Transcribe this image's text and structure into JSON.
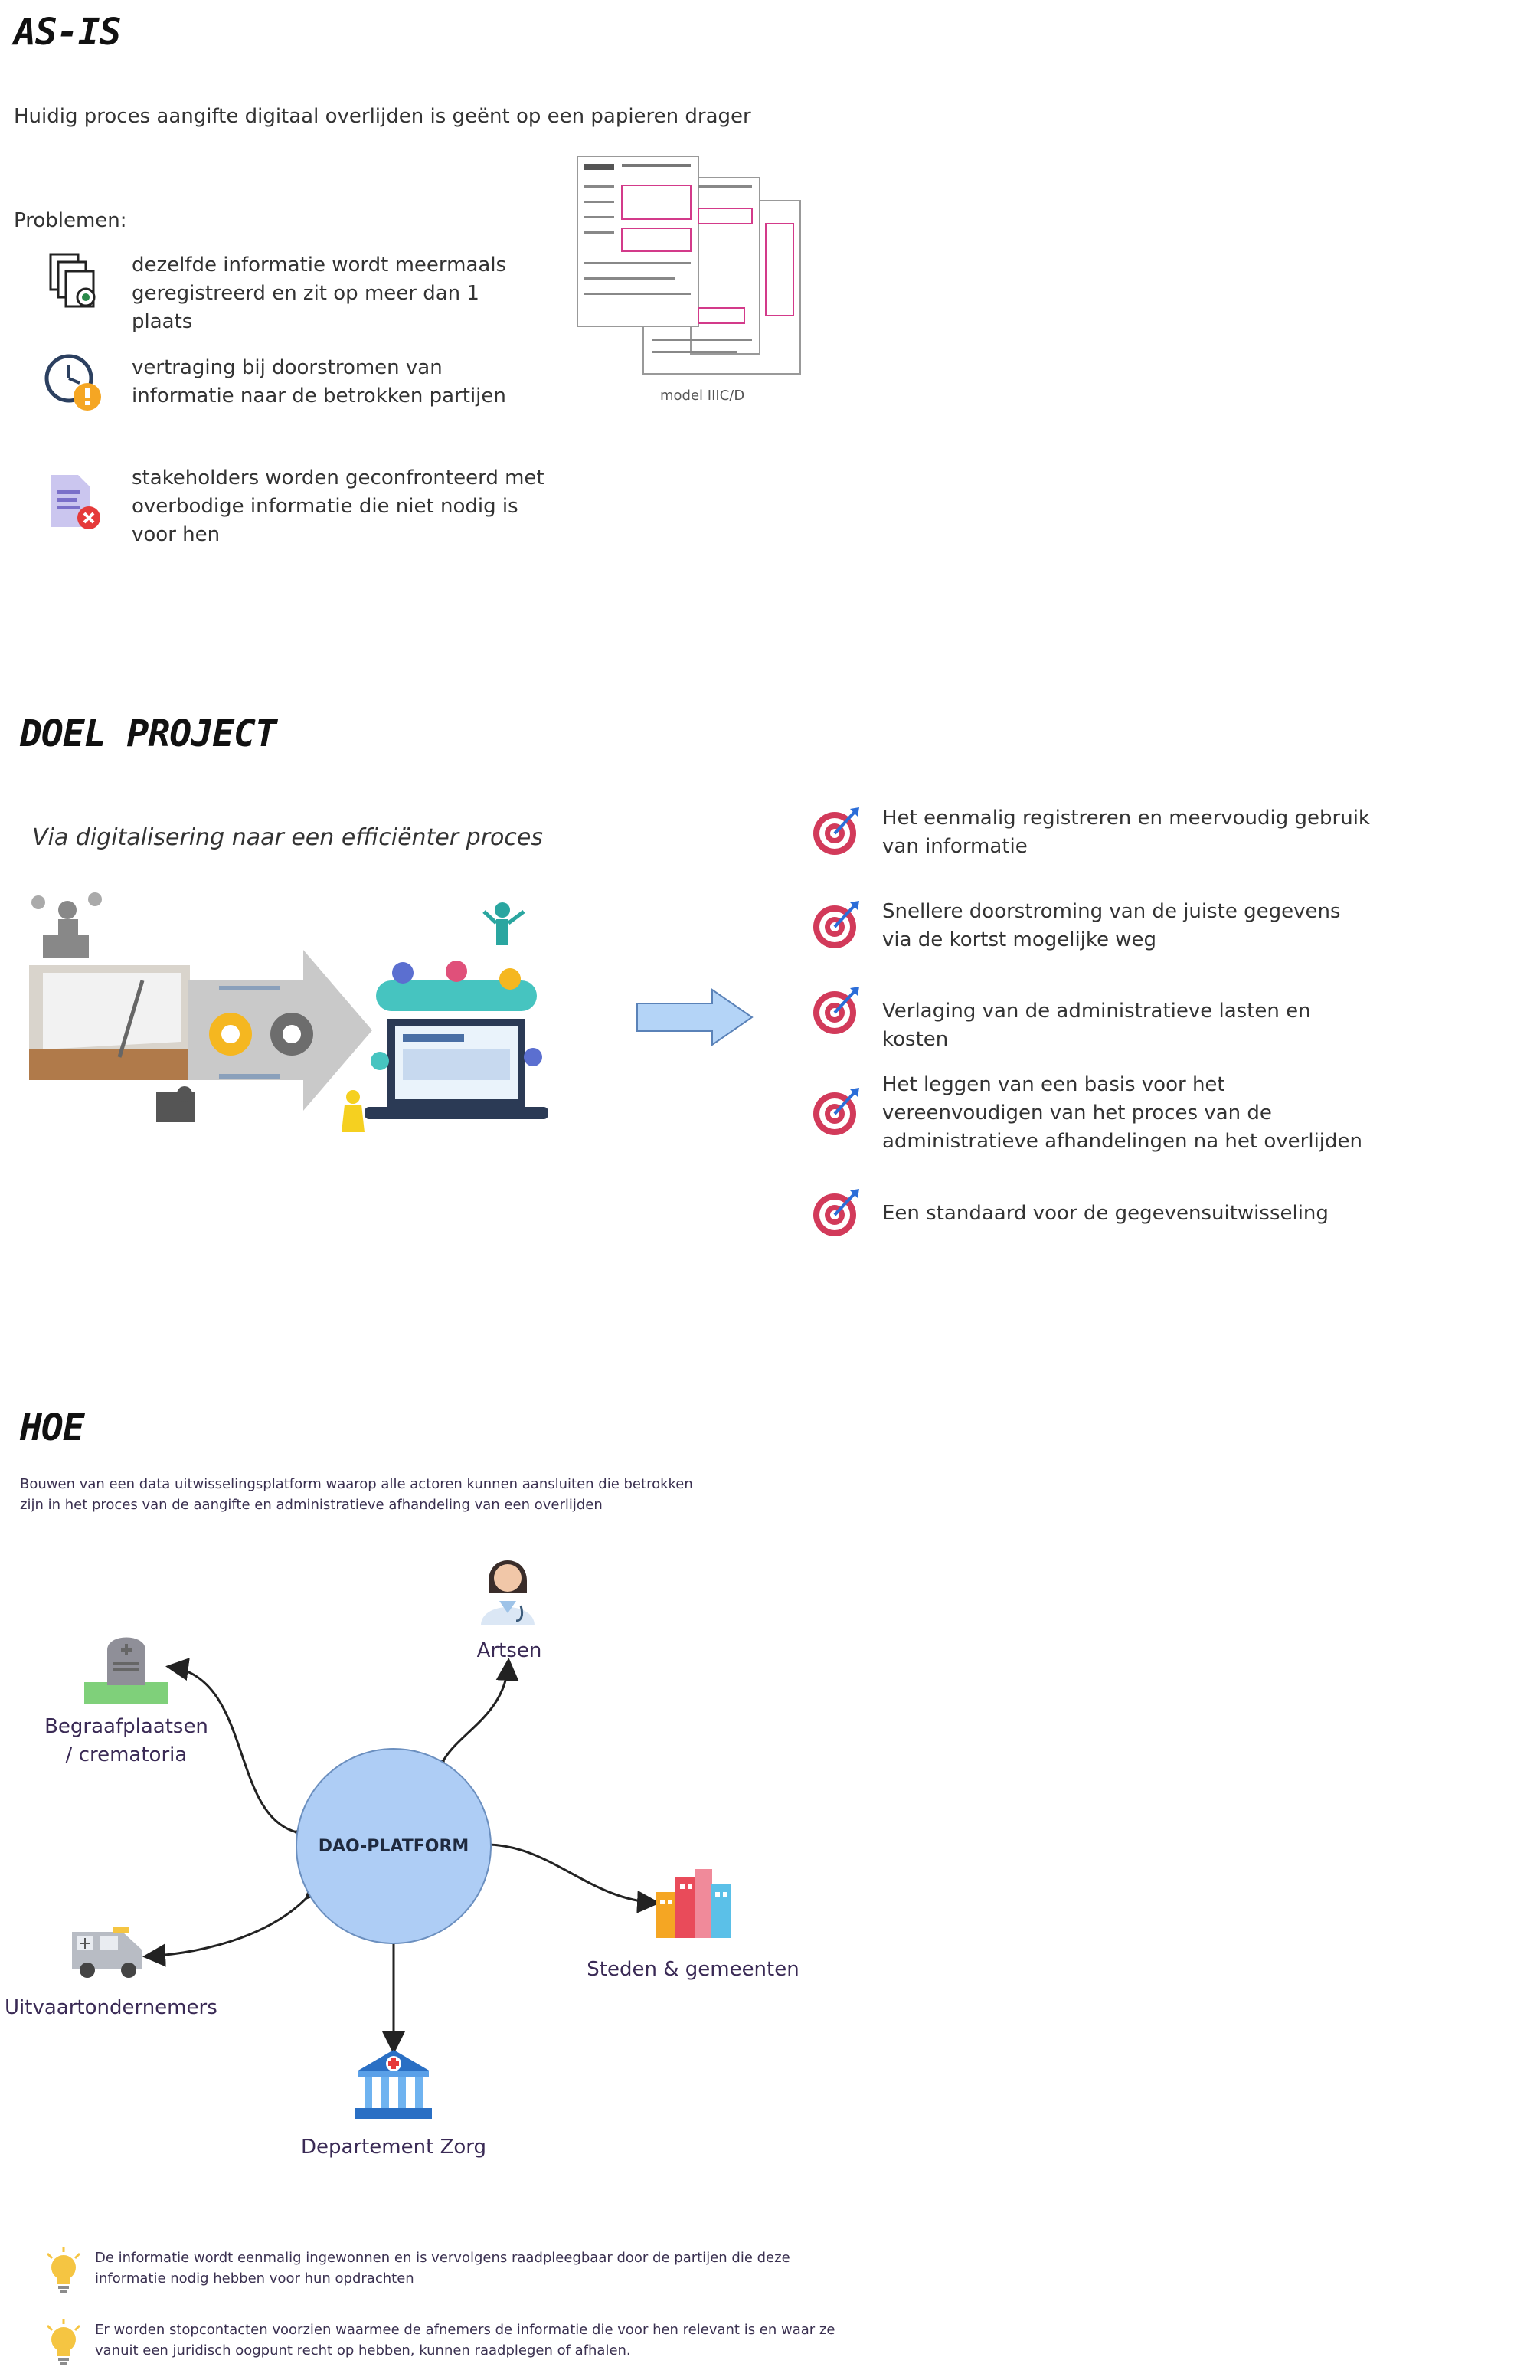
{
  "asis": {
    "title": "AS-IS",
    "intro": "Huidig proces aangifte digitaal overlijden is geënt op een papieren drager",
    "problems_label": "Problemen:",
    "problems": [
      {
        "icon": "documents-icon",
        "text": "dezelfde informatie wordt meermaals geregistreerd en zit op meer dan 1 plaats"
      },
      {
        "icon": "clock-warning-icon",
        "text": "vertraging  bij doorstromen van informatie naar de betrokken partijen"
      },
      {
        "icon": "document-error-icon",
        "text": "stakeholders worden geconfronteerd met overbodige informatie die niet nodig is voor hen"
      }
    ],
    "form_caption": "model IIIC/D"
  },
  "doel": {
    "title": "DOEL PROJECT",
    "subtitle": "Via digitalisering naar een efficiënter proces",
    "goals": [
      "Het eenmalig registreren en meervoudig gebruik van informatie",
      "Snellere doorstroming van de juiste gegevens via de kortst mogelijke weg",
      "Verlaging van de administratieve lasten en kosten",
      "Het leggen van een basis voor het vereenvoudigen van het proces van de administratieve afhandelingen na het overlijden",
      "Een standaard voor de gegevensuitwisseling"
    ]
  },
  "hoe": {
    "title": "HOE",
    "description": "Bouwen van een data uitwisselingsplatform waarop alle actoren kunnen aansluiten die betrokken zijn in het proces van de aangifte en administratieve afhandeling van een overlijden",
    "platform": "DAO-PLATFORM",
    "actors": {
      "artsen": "Artsen",
      "begraaf": "Begraafplaatsen / crematoria",
      "steden": "Steden & gemeenten",
      "uitvaart": "Uitvaartondernemers",
      "zorg": "Departement Zorg"
    },
    "notes": [
      "De informatie wordt eenmalig ingewonnen en is vervolgens raadpleegbaar door de partijen die deze informatie nodig hebben voor hun opdrachten",
      "Er worden stopcontacten voorzien waarmee de afnemers de informatie die voor hen relevant is en waar ze vanuit een juridisch oogpunt recht op hebben, kunnen raadplegen of afhalen."
    ]
  },
  "colors": {
    "platform_fill": "#aecdf5",
    "arrow_fill": "#b4d4f7",
    "target_red": "#d23a5a",
    "bulb_yellow": "#f5c542"
  }
}
